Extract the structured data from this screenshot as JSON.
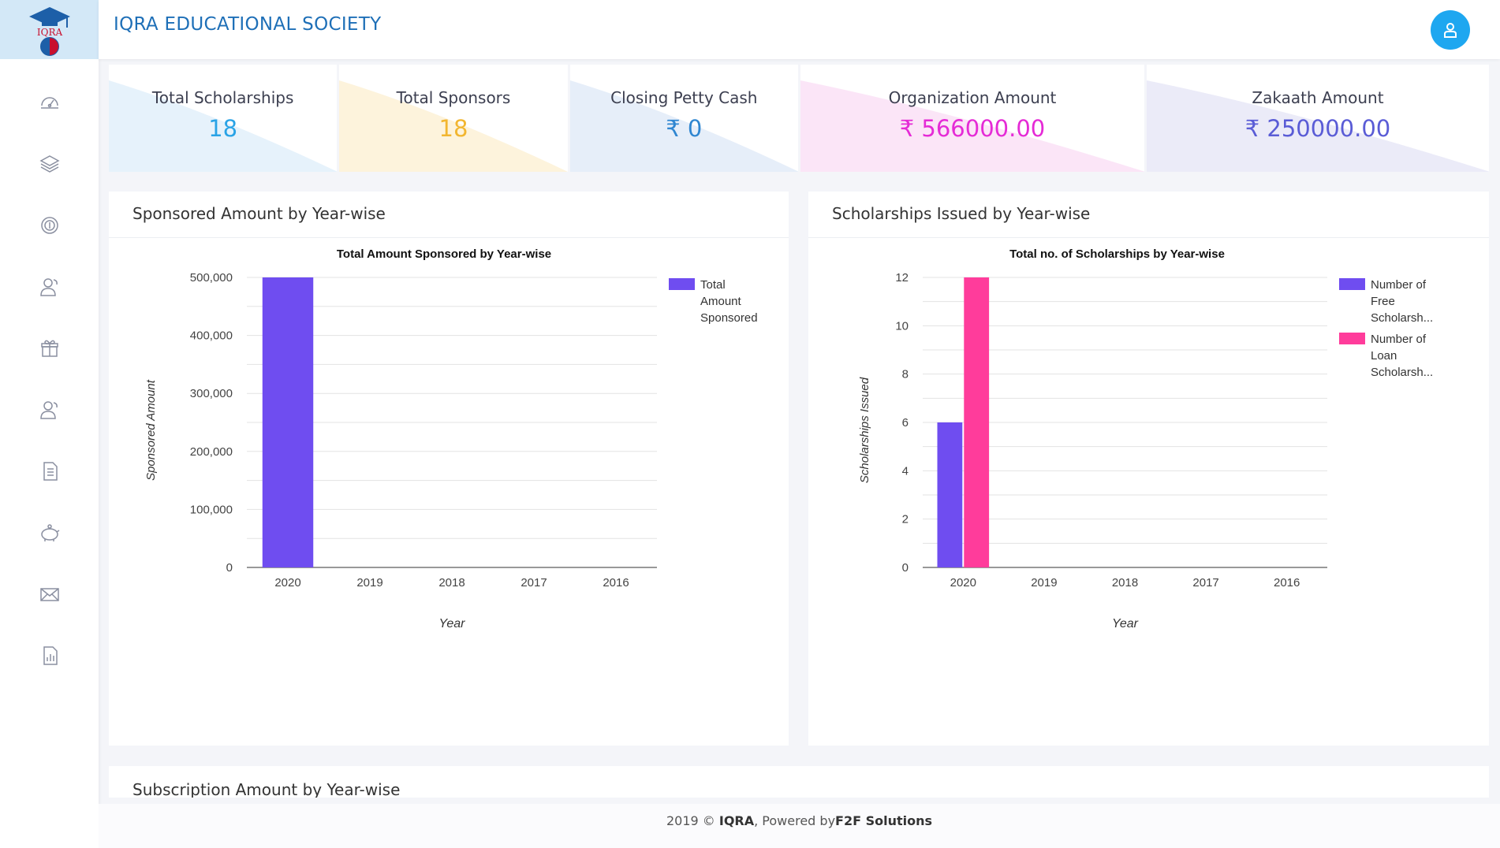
{
  "header": {
    "title": "IQRA EDUCATIONAL SOCIETY"
  },
  "logo": {
    "text": "IQRA"
  },
  "sidebar": {
    "items": [
      {
        "icon": "dashboard-icon"
      },
      {
        "icon": "layers-icon"
      },
      {
        "icon": "money-icon"
      },
      {
        "icon": "users-icon"
      },
      {
        "icon": "gift-icon"
      },
      {
        "icon": "users-icon"
      },
      {
        "icon": "document-icon"
      },
      {
        "icon": "piggy-bank-icon"
      },
      {
        "icon": "mail-icon"
      },
      {
        "icon": "report-icon"
      }
    ]
  },
  "stats": [
    {
      "label": "Total Scholarships",
      "value": "18",
      "color": "#29a3e6",
      "tint": "#e6f2fb"
    },
    {
      "label": "Total Sponsors",
      "value": "18",
      "color": "#f2b630",
      "tint": "#fdf3dc"
    },
    {
      "label": "Closing Petty Cash",
      "value": "₹ 0",
      "color": "#2f86d1",
      "tint": "#e6eef9"
    },
    {
      "label": "Organization Amount",
      "value": "₹ 566000.00",
      "color": "#e52bd6",
      "tint": "#fbe5f7"
    },
    {
      "label": "Zakaath Amount",
      "value": "₹ 250000.00",
      "color": "#5a5cd6",
      "tint": "#ebebf8"
    }
  ],
  "panels": {
    "sponsored": {
      "title": "Sponsored Amount by Year-wise"
    },
    "scholarships": {
      "title": "Scholarships Issued by Year-wise"
    },
    "subscription": {
      "title": "Subscription Amount by Year-wise"
    }
  },
  "footer": {
    "year": "2019 ©",
    "brand": "IQRA",
    "powered": ",  Powered by",
    "company": "F2F Solutions"
  },
  "chart_data": [
    {
      "type": "bar",
      "title": "Total Amount Sponsored by Year-wise",
      "xlabel": "Year",
      "ylabel": "Sponsored Amount",
      "categories": [
        "2020",
        "2019",
        "2018",
        "2017",
        "2016"
      ],
      "series": [
        {
          "name": "Total Amount Sponsored",
          "values": [
            500000,
            0,
            0,
            0,
            0
          ],
          "color": "#6f4df0"
        }
      ],
      "ylim": [
        0,
        500000
      ],
      "yticks": [
        0,
        100000,
        200000,
        300000,
        400000,
        500000
      ],
      "ytick_labels": [
        "0",
        "100,000",
        "200,000",
        "300,000",
        "400,000",
        "500,000"
      ],
      "legend_lines": [
        [
          "Total",
          "Amount",
          "Sponsored"
        ]
      ],
      "grid": true,
      "legend": "right"
    },
    {
      "type": "bar",
      "title": "Total no. of Scholarships by Year-wise",
      "xlabel": "Year",
      "ylabel": "Scholarships Issued",
      "categories": [
        "2020",
        "2019",
        "2018",
        "2017",
        "2016"
      ],
      "series": [
        {
          "name": "Number of Free Scholarsh...",
          "values": [
            6,
            0,
            0,
            0,
            0
          ],
          "color": "#6f4df0"
        },
        {
          "name": "Number of Loan Scholarsh...",
          "values": [
            12,
            0,
            0,
            0,
            0
          ],
          "color": "#ff3c9b"
        }
      ],
      "ylim": [
        0,
        12
      ],
      "yticks": [
        0,
        2,
        4,
        6,
        8,
        10,
        12
      ],
      "ytick_labels": [
        "0",
        "2",
        "4",
        "6",
        "8",
        "10",
        "12"
      ],
      "legend_lines": [
        [
          "Number of",
          "Free",
          "Scholarsh..."
        ],
        [
          "Number of",
          "Loan",
          "Scholarsh..."
        ]
      ],
      "grid": true,
      "legend": "right"
    }
  ]
}
